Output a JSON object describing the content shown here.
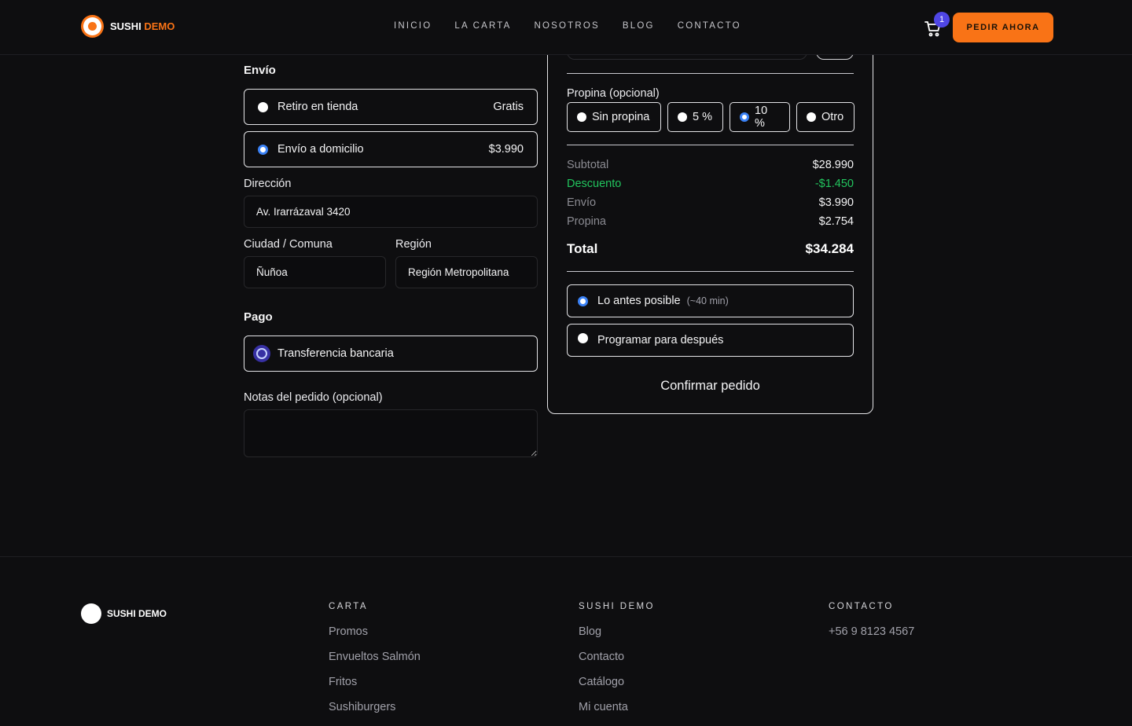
{
  "header": {
    "brand_primary": "SUSHI",
    "brand_secondary": "DEMO",
    "nav": [
      "INICIO",
      "LA CARTA",
      "NOSOTROS",
      "BLOG",
      "CONTACTO"
    ],
    "cart_count": "1",
    "cta_label": "PEDIR AHORA"
  },
  "shipping": {
    "title": "Envío",
    "options": [
      {
        "label": "Retiro en tienda",
        "price": "Gratis",
        "selected": false
      },
      {
        "label": "Envío a domicilio",
        "price": "$3.990",
        "selected": true
      }
    ]
  },
  "address": {
    "label": "Dirección",
    "value": "Av. Irarrázaval 3420",
    "city_label": "Ciudad / Comuna",
    "city_value": "Ñuñoa",
    "region_label": "Región",
    "region_value": "Región Metropolitana"
  },
  "payment": {
    "title": "Pago",
    "option": "Transferencia bancaria"
  },
  "notes": {
    "label": "Notas del pedido (opcional)",
    "value": ""
  },
  "summary": {
    "tip_label": "Propina (opcional)",
    "tips": [
      {
        "label": "Sin propina",
        "selected": false
      },
      {
        "label": "5 %",
        "selected": false
      },
      {
        "label": "10 %",
        "selected": true
      },
      {
        "label": "Otro",
        "selected": false
      }
    ],
    "lines": {
      "subtotal_label": "Subtotal",
      "subtotal": "$28.990",
      "discount_label": "Descuento",
      "discount": "-$1.450",
      "shipping_label": "Envío",
      "shipping": "$3.990",
      "tip_label": "Propina",
      "tip": "$2.754",
      "total_label": "Total",
      "total": "$34.284"
    },
    "timing": {
      "asap_label": "Lo antes posible",
      "asap_hint": "(~40 min)",
      "later_label": "Programar para después"
    },
    "confirm_label": "Confirmar pedido"
  },
  "footer": {
    "brand": "SUSHI DEMO",
    "columns": [
      {
        "title": "CARTA",
        "links": [
          "Promos",
          "Envueltos Salmón",
          "Fritos",
          "Sushiburgers"
        ]
      },
      {
        "title": "SUSHI DEMO",
        "links": [
          "Blog",
          "Contacto",
          "Catálogo",
          "Mi cuenta"
        ]
      },
      {
        "title": "CONTACTO",
        "links": [
          "+56 9 8123 4567"
        ]
      }
    ]
  },
  "colors": {
    "accent": "#f97316",
    "badge": "#4f46e5",
    "discount": "#22c55e",
    "radio_selected": "#3b82f6"
  }
}
